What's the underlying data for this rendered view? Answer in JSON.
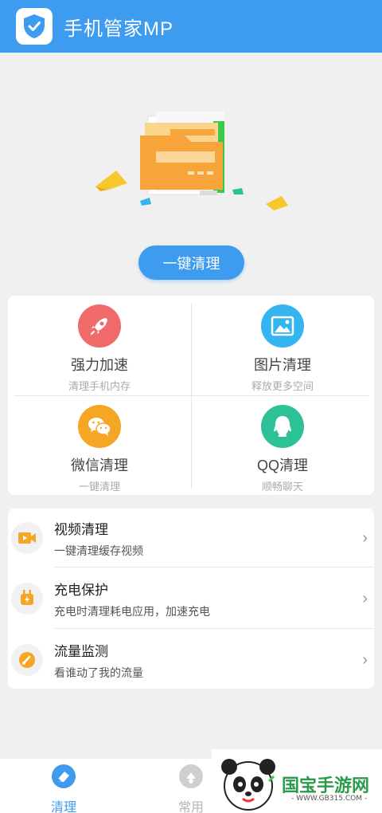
{
  "header": {
    "title": "手机管家MP",
    "logo_icon": "shield-check-icon"
  },
  "hero": {
    "illustration": "folder-illustration",
    "button_label": "一键清理"
  },
  "grid": [
    {
      "title": "强力加速",
      "subtitle": "清理手机内存",
      "icon": "rocket-icon",
      "color": "#f06a6a"
    },
    {
      "title": "图片清理",
      "subtitle": "释放更多空间",
      "icon": "image-icon",
      "color": "#35b5ef"
    },
    {
      "title": "微信清理",
      "subtitle": "一键清理",
      "icon": "wechat-icon",
      "color": "#f5a623"
    },
    {
      "title": "QQ清理",
      "subtitle": "顺畅聊天",
      "icon": "qq-icon",
      "color": "#2cc197"
    }
  ],
  "list": [
    {
      "title": "视频清理",
      "subtitle": "一键清理缓存视频",
      "icon": "video-icon"
    },
    {
      "title": "充电保护",
      "subtitle": "充电时清理耗电应用，加速充电",
      "icon": "plug-icon"
    },
    {
      "title": "流量监测",
      "subtitle": "看谁动了我的流量",
      "icon": "gauge-icon"
    }
  ],
  "bottom_nav": [
    {
      "label": "清理",
      "icon": "eraser-icon",
      "active": true
    },
    {
      "label": "常用",
      "icon": "common-icon",
      "active": false
    }
  ],
  "watermark": {
    "name": "国宝手游网",
    "url": "- WWW.GB315.COM -"
  },
  "colors": {
    "primary": "#3d9bf0",
    "background": "#f0f0f0"
  }
}
